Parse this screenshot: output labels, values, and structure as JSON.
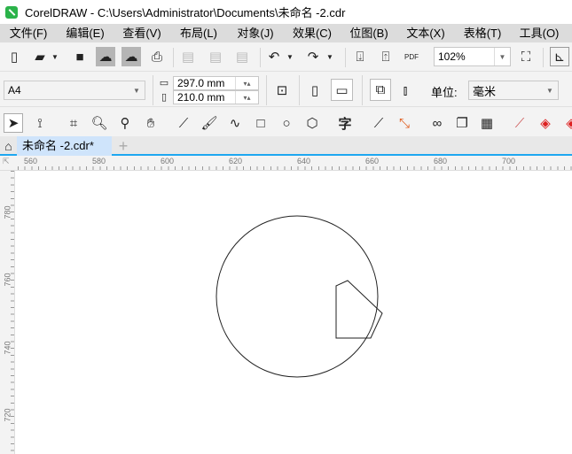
{
  "title": "CorelDRAW - C:\\Users\\Administrator\\Documents\\未命名 -2.cdr",
  "menu": [
    "文件(F)",
    "编辑(E)",
    "查看(V)",
    "布局(L)",
    "对象(J)",
    "效果(C)",
    "位图(B)",
    "文本(X)",
    "表格(T)",
    "工具(O)"
  ],
  "toolbar": {
    "zoom": "102%",
    "pdf": "PDF"
  },
  "property": {
    "page_size": "A4",
    "width": "297.0 mm",
    "height": "210.0 mm",
    "unit_label": "单位:",
    "unit": "毫米"
  },
  "tools": {
    "text_tool": "字"
  },
  "tab": {
    "name": "未命名 -2.cdr*",
    "add": "+"
  },
  "ruler": {
    "h": [
      "560",
      "580",
      "600",
      "620",
      "640",
      "660",
      "680",
      "700"
    ],
    "v": [
      "780",
      "760",
      "740",
      "720"
    ]
  }
}
